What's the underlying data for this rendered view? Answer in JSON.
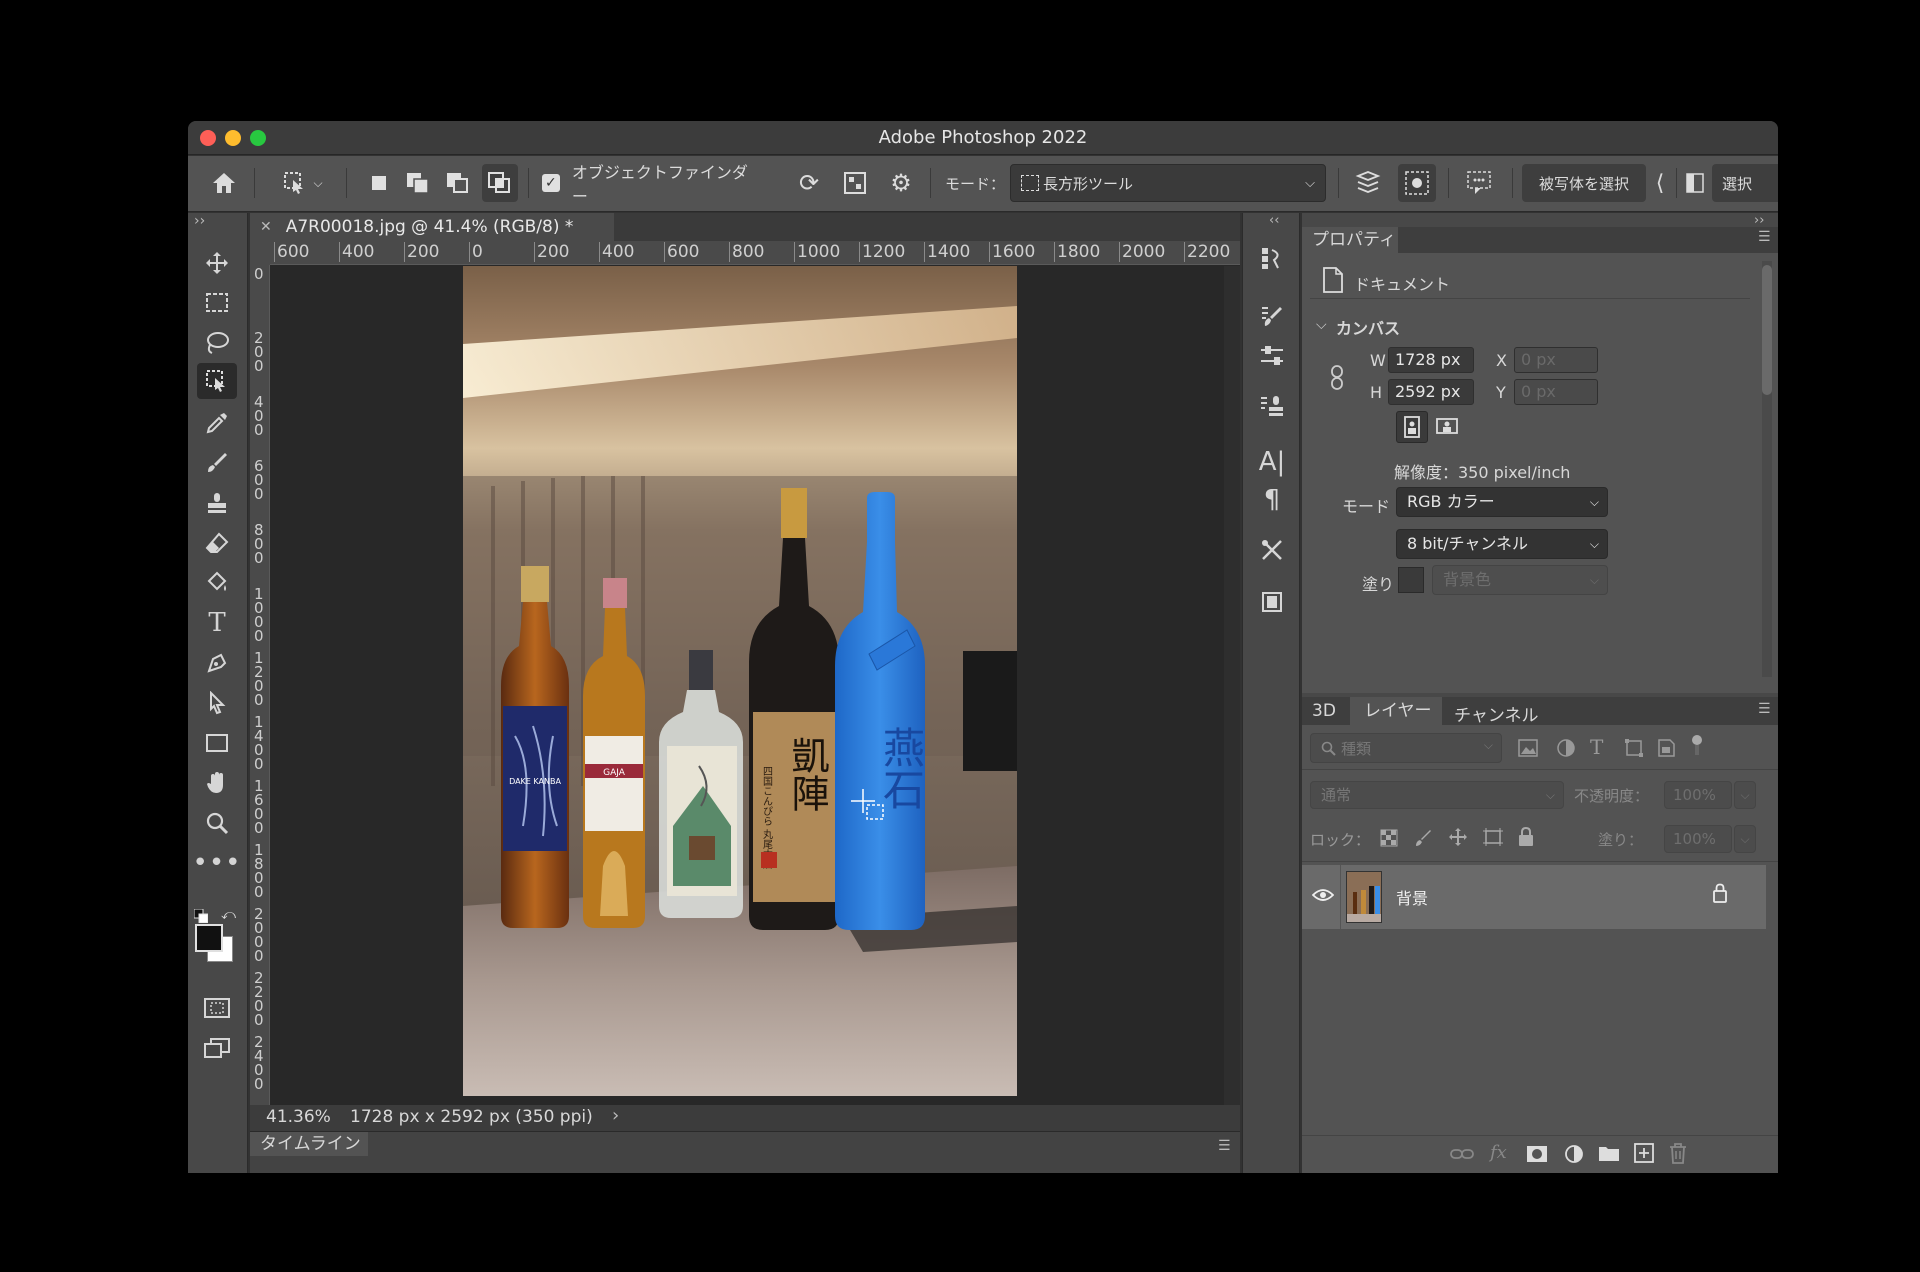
{
  "window": {
    "title": "Adobe Photoshop 2022"
  },
  "options_bar": {
    "object_finder_label": "オブジェクトファインダー",
    "mode_label": "モード：",
    "mode_value": "長方形ツール",
    "select_subject_label": "被写体を選択",
    "select_label": "選択"
  },
  "document": {
    "tab_title": "A7R00018.jpg @ 41.4% (RGB/8) *",
    "ruler_h_ticks": [
      "600",
      "400",
      "200",
      "0",
      "200",
      "400",
      "600",
      "800",
      "1000",
      "1200",
      "1400",
      "1600",
      "1800",
      "2000",
      "2200"
    ],
    "ruler_v_ticks": [
      "0",
      "2 0 0",
      "4 0 0",
      "6 0 0",
      "8 0 0",
      "1 0 0 0",
      "1 2 0 0",
      "1 4 0 0",
      "1 6 0 0",
      "1 8 0 0",
      "2 0 0 0",
      "2 2 0 0",
      "2 4 0 0"
    ],
    "zoom": "41.36%",
    "size_info": "1728 px x 2592 px (350 ppi)",
    "timeline_label": "タイムライン"
  },
  "properties": {
    "tab": "プロパティ",
    "doc_label": "ドキュメント",
    "canvas_section": "カンバス",
    "w_label": "W",
    "w_value": "1728 px",
    "h_label": "H",
    "h_value": "2592 px",
    "x_label": "X",
    "x_value": "0 px",
    "y_label": "Y",
    "y_value": "0 px",
    "resolution": "解像度：350 pixel/inch",
    "mode_label": "モード",
    "mode_value": "RGB カラー",
    "bit_value": "8 bit/チャンネル",
    "fill_label": "塗り",
    "fill_value": "背景色"
  },
  "layers_panel": {
    "tabs": [
      "3D",
      "レイヤー",
      "チャンネル"
    ],
    "filter_placeholder": "種類",
    "blend_mode": "通常",
    "opacity_label": "不透明度：",
    "opacity_value": "100%",
    "lock_label": "ロック：",
    "fill_label": "塗り：",
    "fill_value": "100%",
    "layers": [
      {
        "name": "背景"
      }
    ]
  },
  "bottle_labels": {
    "b1": "DAKE KANBA",
    "b2": "GAJA",
    "b4": "四国こんぴら 丸尾本店",
    "b4big": "凱陣",
    "b5": "燕石"
  }
}
